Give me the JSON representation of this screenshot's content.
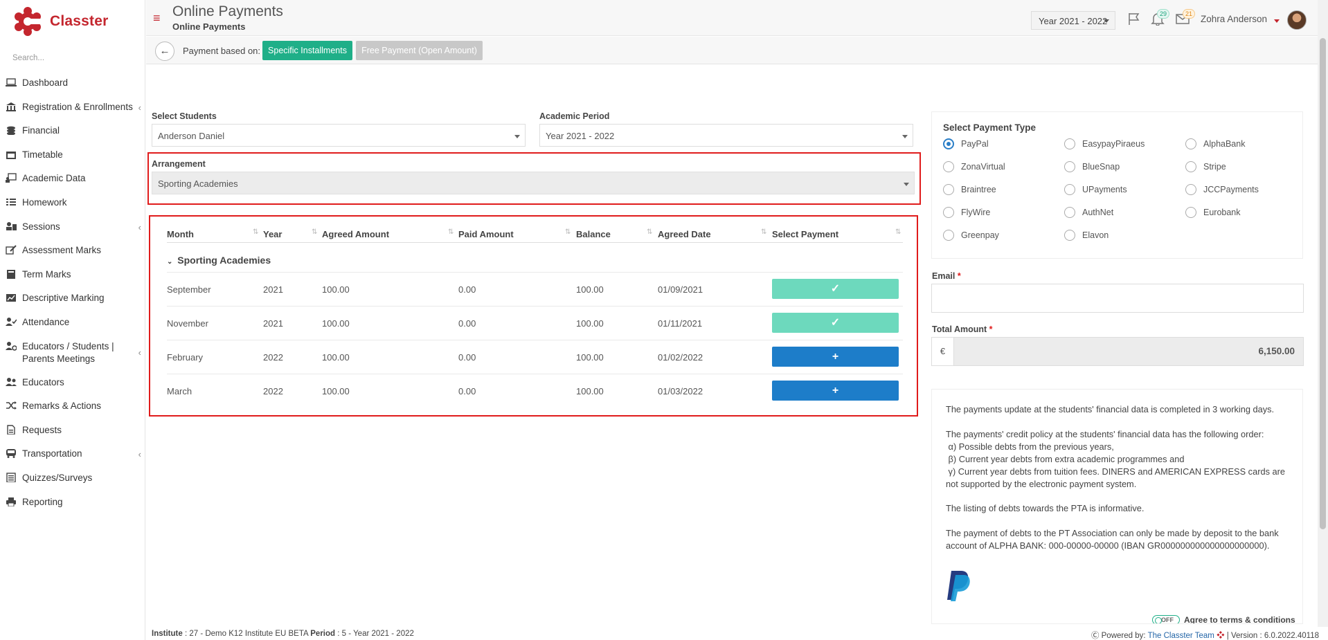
{
  "app": {
    "name": "Classter",
    "brand_color": "#c4262e",
    "accent_color": "#1faf88"
  },
  "sidebar": {
    "search_placeholder": "Search...",
    "items": [
      {
        "label": "Dashboard",
        "icon": "laptop-icon",
        "chevron": false
      },
      {
        "label": "Registration & Enrollments",
        "icon": "institution-icon",
        "chevron": true
      },
      {
        "label": "Financial",
        "icon": "coins-icon",
        "chevron": false
      },
      {
        "label": "Timetable",
        "icon": "calendar-icon",
        "chevron": false
      },
      {
        "label": "Academic Data",
        "icon": "chalkboard-icon",
        "chevron": false
      },
      {
        "label": "Homework",
        "icon": "list-icon",
        "chevron": false
      },
      {
        "label": "Sessions",
        "icon": "sessions-icon",
        "chevron": true
      },
      {
        "label": "Assessment Marks",
        "icon": "edit-icon",
        "chevron": false
      },
      {
        "label": "Term Marks",
        "icon": "notebook-icon",
        "chevron": false
      },
      {
        "label": "Descriptive Marking",
        "icon": "chart-icon",
        "chevron": false
      },
      {
        "label": "Attendance",
        "icon": "user-check-icon",
        "chevron": false
      },
      {
        "label": "Educators / Students | Parents Meetings",
        "icon": "user-gear-icon",
        "chevron": true
      },
      {
        "label": "Educators",
        "icon": "users-icon",
        "chevron": false
      },
      {
        "label": "Remarks & Actions",
        "icon": "shuffle-icon",
        "chevron": false
      },
      {
        "label": "Requests",
        "icon": "document-icon",
        "chevron": false
      },
      {
        "label": "Transportation",
        "icon": "bus-icon",
        "chevron": true
      },
      {
        "label": "Quizzes/Surveys",
        "icon": "checklist-icon",
        "chevron": false
      },
      {
        "label": "Reporting",
        "icon": "printer-icon",
        "chevron": false
      }
    ]
  },
  "header": {
    "title": "Online Payments",
    "subtitle": "Online Payments",
    "year_selector": "Year 2021 - 2022",
    "notifications_count": "29",
    "messages_count": "21",
    "user_name": "Zohra Anderson"
  },
  "subbar": {
    "payment_based_label": "Payment based on:",
    "specific_installments": "Specific Installments",
    "free_payment": "Free Payment (Open Amount)"
  },
  "form": {
    "select_students_label": "Select Students",
    "select_students_value": "Anderson Daniel",
    "academic_period_label": "Academic Period",
    "academic_period_value": "Year 2021 - 2022",
    "arrangement_label": "Arrangement",
    "arrangement_value": "Sporting Academies"
  },
  "table": {
    "columns": [
      "Month",
      "Year",
      "Agreed Amount",
      "Paid Amount",
      "Balance",
      "Agreed Date",
      "Select Payment"
    ],
    "group": "Sporting Academies",
    "rows": [
      {
        "month": "September",
        "year": "2021",
        "agreed": "100.00",
        "paid": "0.00",
        "balance": "100.00",
        "date": "01/09/2021",
        "selected": true
      },
      {
        "month": "November",
        "year": "2021",
        "agreed": "100.00",
        "paid": "0.00",
        "balance": "100.00",
        "date": "01/11/2021",
        "selected": true
      },
      {
        "month": "February",
        "year": "2022",
        "agreed": "100.00",
        "paid": "0.00",
        "balance": "100.00",
        "date": "01/02/2022",
        "selected": false
      },
      {
        "month": "March",
        "year": "2022",
        "agreed": "100.00",
        "paid": "0.00",
        "balance": "100.00",
        "date": "01/03/2022",
        "selected": false
      }
    ]
  },
  "payment": {
    "title": "Select Payment Type",
    "selected": "PayPal",
    "options": [
      "PayPal",
      "EasypayPiraeus",
      "AlphaBank",
      "ZonaVirtual",
      "BlueSnap",
      "Stripe",
      "Braintree",
      "UPayments",
      "JCCPayments",
      "FlyWire",
      "AuthNet",
      "Eurobank",
      "Greenpay",
      "Elavon"
    ],
    "email_label": "Email",
    "required_mark": "*",
    "total_label": "Total Amount",
    "currency": "€",
    "total_value": "6,150.00"
  },
  "info": {
    "p1": "The payments update at the students' financial data is completed in 3 working days.",
    "p2_lines": [
      "The payments' credit policy at the students' financial data has the following order:",
      " α) Possible debts from the previous years,",
      " β) Current year debts from extra academic programmes and",
      " γ) Current year debts from tuition fees. DINERS and AMERICAN EXPRESS cards are",
      "not supported by the electronic payment system."
    ],
    "p3": "The listing of debts towards the PTA is informative.",
    "p4_lines": [
      "The payment of debts to the PT Association can only be made by deposit to the bank",
      "account of ALPHA BANK: 000-00000-00000 (IBAN GR000000000000000000000)."
    ],
    "toggle_label": "OFF",
    "agree_label": "Agree to terms & conditions"
  },
  "footer": {
    "institute_label": "Institute",
    "institute_value": ": 27 - Demo K12 Institute EU BETA",
    "period_label": "Period",
    "period_value": ": 5 - Year 2021 - 2022",
    "powered_by": "Powered by:",
    "team": "The Classter Team",
    "version": "| Version : 6.0.2022.40118"
  }
}
